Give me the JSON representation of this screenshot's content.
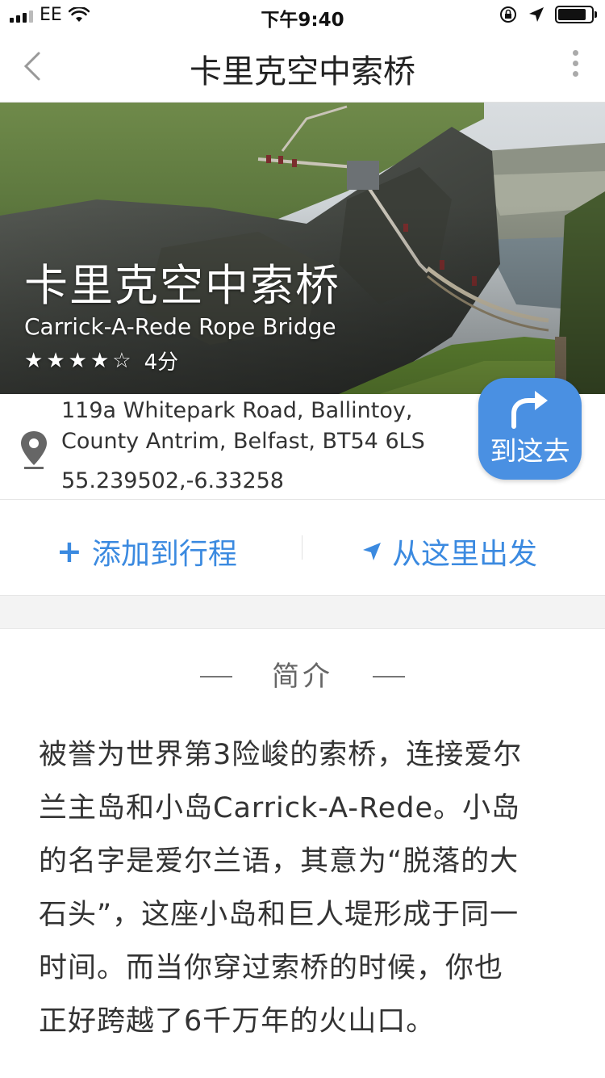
{
  "status_bar": {
    "carrier": "EE",
    "time": "下午9:40"
  },
  "nav": {
    "title": "卡里克空中索桥"
  },
  "hero": {
    "title_cn": "卡里克空中索桥",
    "title_en": "Carrick-A-Rede Rope Bridge",
    "rating": 4,
    "rating_max": 5,
    "rating_text": "4分"
  },
  "address": {
    "line1": "119a Whitepark Road, Ballintoy,",
    "line2": "County Antrim, Belfast, BT54 6LS",
    "coords": "55.239502,-6.33258",
    "goto_label": "到这去"
  },
  "actions": {
    "add_label": "添加到行程",
    "depart_label": "从这里出发"
  },
  "intro": {
    "heading": "简介",
    "body_lines": [
      "被誉为世界第3险峻的索桥，连接爱尔",
      "兰主岛和小岛Carrick-A-Rede。小岛",
      "的名字是爱尔兰语，其意为“脱落的大",
      "石头”，这座小岛和巨人堤形成于同一",
      "时间。而当你穿过索桥的时候，你也",
      "正好跨越了6千万年的火山口。"
    ]
  },
  "colors": {
    "accent": "#3b8ae0",
    "goto_button": "#4a90e2"
  }
}
